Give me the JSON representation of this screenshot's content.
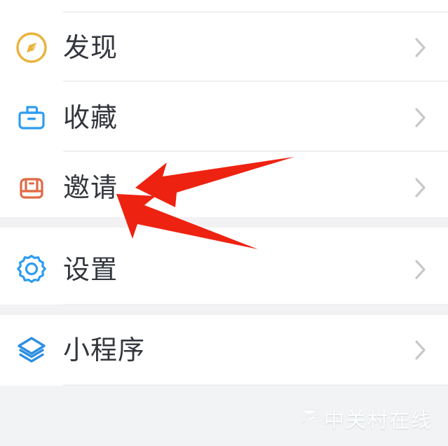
{
  "app": {
    "background_color": "#f1f3f5",
    "panel_color": "#ffffff",
    "divider_color": "#f0f0f2",
    "band_color": "#f2f2f4",
    "label_color": "#33373d",
    "chevron_color": "#c8c8cc",
    "annotation_color": "#ee2211"
  },
  "list": {
    "groups": [
      {
        "group_name": "primary-group",
        "items": [
          {
            "label": "发现",
            "icon": "compass-icon",
            "icon_color": "#e8b33a",
            "chevron": "chevron-right-icon",
            "name": "list-item-discover"
          },
          {
            "label": "收藏",
            "icon": "folder-icon",
            "icon_color": "#2d9cf0",
            "chevron": "chevron-right-icon",
            "name": "list-item-favorites"
          },
          {
            "label": "邀请",
            "icon": "mailbox-icon",
            "icon_color": "#e06a45",
            "chevron": "chevron-right-icon",
            "name": "list-item-invite"
          }
        ]
      },
      {
        "group_name": "settings-group",
        "items": [
          {
            "label": "设置",
            "icon": "gear-icon",
            "icon_color": "#2d9cf0",
            "chevron": "chevron-right-icon",
            "name": "list-item-settings"
          }
        ]
      },
      {
        "group_name": "miniprogram-group",
        "items": [
          {
            "label": "小程序",
            "icon": "layers-icon",
            "icon_color": "#2d8fe0",
            "chevron": "chevron-right-icon",
            "name": "list-item-miniprogram"
          }
        ]
      }
    ]
  },
  "annotations": {
    "arrow_color": "#ee2211",
    "arrows": [
      {
        "name": "annotation-arrow-upper",
        "points_to": "邀请"
      },
      {
        "name": "annotation-arrow-lower",
        "points_to": "邀请"
      }
    ]
  },
  "watermark": {
    "text": "中关村在线",
    "logo": "zol-logo-icon",
    "color": "#ffffff"
  }
}
